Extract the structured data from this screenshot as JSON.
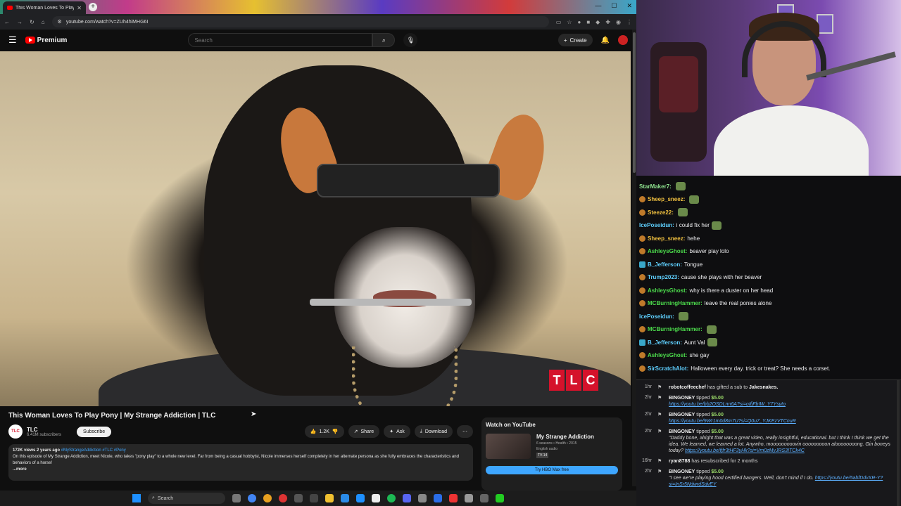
{
  "browser": {
    "tab_title": "This Woman Loves To Play",
    "url": "youtube.com/watch?v=ZUh4hiMHG6I"
  },
  "youtube": {
    "logo_text": "Premium",
    "search_placeholder": "Search",
    "create_label": "Create",
    "video_title": "This Woman Loves To Play Pony | My Strange Addiction | TLC",
    "channel_name": "TLC",
    "channel_avatar_text": "TLC",
    "subscribers": "6.41M subscribers",
    "subscribe_label": "Subscribe",
    "likes": "1.2K",
    "share_label": "Share",
    "ask_label": "Ask",
    "download_label": "Download",
    "watermark": [
      "T",
      "L",
      "C"
    ],
    "description": {
      "meta": "172K views  2 years ago",
      "tags": "#MyStrangeAddiction #TLC #Pony",
      "text": "On this episode of My Strange Addiction, meet Nicole, who takes \"pony play\" to a whole new level. Far from being a casual hobbyist, Nicole immerses herself completely in her alternate persona as she fully embraces the characteristics and behaviors of a horse!",
      "more": "...more"
    },
    "watch_card": {
      "title": "Watch on YouTube",
      "show": "My Strange Addiction",
      "info": "6 seasons • Health • 2015",
      "audio": "English audio",
      "rating": "TV-14",
      "button": "Try HBO Max free"
    }
  },
  "chat": [
    {
      "user": "StarMaker7:",
      "color": "#8fe38f",
      "text": "",
      "badge": "none",
      "emote": true
    },
    {
      "user": "Sheep_sneez:",
      "color": "#f0c040",
      "text": "",
      "badge": "orange",
      "emote": true
    },
    {
      "user": "Steeze22:",
      "color": "#f0c040",
      "text": "",
      "badge": "orange",
      "emote": true
    },
    {
      "user": "IcePoseidun:",
      "color": "#5fd0ff",
      "text": "i could fix her",
      "badge": "none",
      "emote": true
    },
    {
      "user": "Sheep_sneez:",
      "color": "#f0c040",
      "text": "hehe",
      "badge": "orange",
      "emote": false
    },
    {
      "user": "AshleysGhost:",
      "color": "#4cdc4c",
      "text": "beaver play lolo",
      "badge": "orange",
      "emote": false
    },
    {
      "user": "B_Jefferson:",
      "color": "#5fd0ff",
      "text": "Tongue",
      "badge": "blue",
      "emote": false
    },
    {
      "user": "Trump2023:",
      "color": "#5fd0ff",
      "text": "cause she plays with her beaver",
      "badge": "orange",
      "emote": false
    },
    {
      "user": "AshleysGhost:",
      "color": "#4cdc4c",
      "text": "why is there a duster on her head",
      "badge": "orange",
      "emote": false
    },
    {
      "user": "MCBurningHammer:",
      "color": "#4cdc4c",
      "text": "leave the real ponies alone",
      "badge": "orange",
      "emote": false
    },
    {
      "user": "IcePoseidun:",
      "color": "#5fd0ff",
      "text": "",
      "badge": "none",
      "emote": true
    },
    {
      "user": "MCBurningHammer:",
      "color": "#4cdc4c",
      "text": "",
      "badge": "orange",
      "emote": true
    },
    {
      "user": "B_Jefferson:",
      "color": "#5fd0ff",
      "text": "Aunt Val",
      "badge": "blue",
      "emote": true
    },
    {
      "user": "AshleysGhost:",
      "color": "#4cdc4c",
      "text": "she gay",
      "badge": "orange",
      "emote": false
    },
    {
      "user": "SirScratchAlot:",
      "color": "#5fd0ff",
      "text": "Halloween every day. trick or treat? She needs a corset.",
      "badge": "orange",
      "emote": false
    }
  ],
  "events": [
    {
      "time": "1hr",
      "who": "robotcoffeechef",
      "action": "has gifted a sub to",
      "target": "Jakesnakes.",
      "amount": "",
      "link": "",
      "quote": ""
    },
    {
      "time": "2hr",
      "who": "BINGONEY",
      "action": "tipped",
      "target": "",
      "amount": "$5.00",
      "link": "https://youtu.be/bb2OSDLnn6A?si=oIfjFbIW_Y7Ysyto",
      "quote": ""
    },
    {
      "time": "2hr",
      "who": "BINGONEY",
      "action": "tipped",
      "target": "",
      "amount": "$5.00",
      "link": "https://youtu.be/9Wr1m0d8m7U?si=Q0u7_YJKEzVTCnuR",
      "quote": ""
    },
    {
      "time": "2hr",
      "who": "BINGONEY",
      "action": "tipped",
      "target": "",
      "amount": "$5.00",
      "link": "https://youtu.be/fjfr3tHF3yHk?si=Vm0zMyJRS3ITCk4C",
      "quote": "\"Daddy bone, alright that was a great video, really insightful, educational. but I think I think we get the idea. We learned, we learned a lot. Anywho, mooooooooovin ooooooooon aloooooooong. Gin boneys today?"
    },
    {
      "time": "16hr",
      "who": "ryan8788",
      "action": "has resubscribed for 2 months",
      "target": "",
      "amount": "",
      "link": "",
      "quote": ""
    },
    {
      "time": "2hr",
      "who": "BINGONEY",
      "action": "tipped",
      "target": "",
      "amount": "$5.00",
      "link": "https://youtu.be/5abfDdvXR-Y?si=InSr5NdwrdSdvEY",
      "quote": "\"I see we're playing hood certified bangers. Well, don't mind if I do."
    }
  ],
  "taskbar": {
    "search_label": "Search"
  }
}
